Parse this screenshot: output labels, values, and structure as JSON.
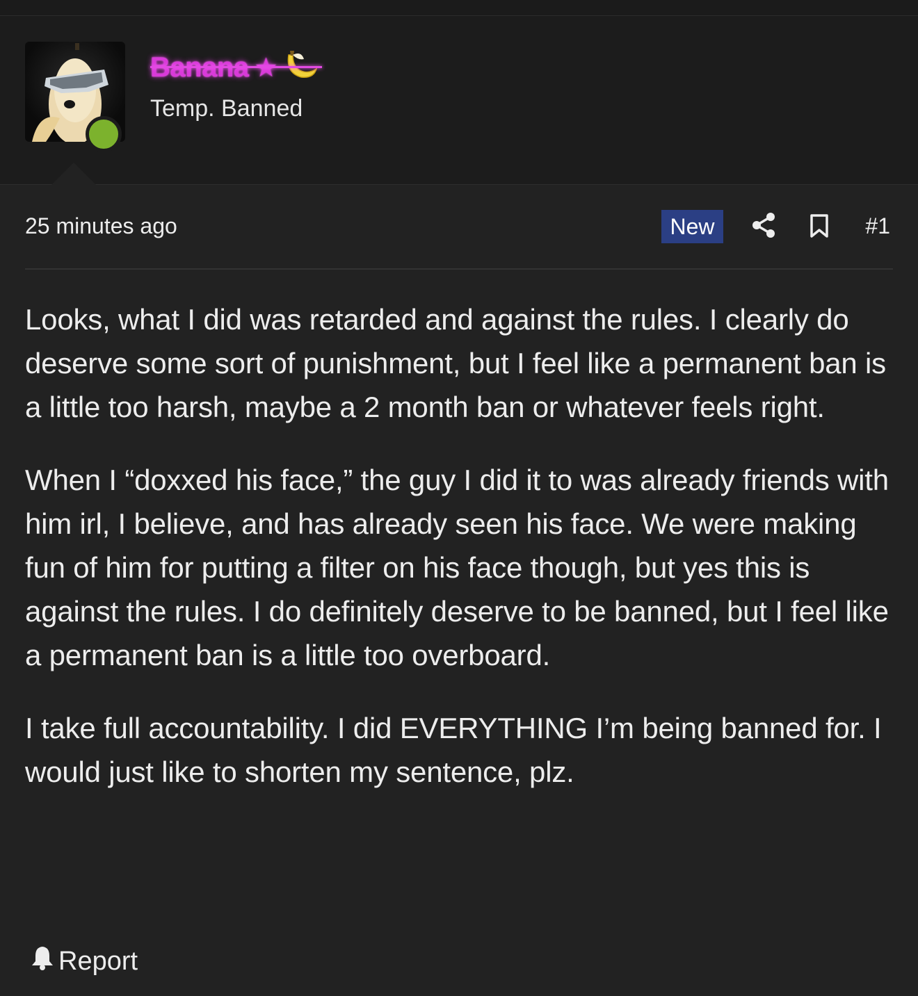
{
  "user": {
    "name": "Banana",
    "title": "Temp. Banned",
    "status": "online",
    "name_color": "#d93ad9",
    "status_color": "#7cb22d",
    "name_decorations": [
      "star-icon",
      "banana-icon"
    ]
  },
  "post": {
    "timestamp": "25 minutes ago",
    "badge": "New",
    "badge_color": "#2b3f84",
    "number": "#1",
    "paragraphs": [
      "Looks, what I did was retarded and against the rules. I clearly do deserve some sort of punishment, but I feel like a permanent ban is a little too harsh, maybe a 2 month ban or whatever feels right.",
      "When I “doxxed his face,” the guy I did it to was already friends with him irl, I believe, and has already seen his face. We were making fun of him for putting a filter on his face though, but yes this is against the rules. I do definitely deserve to be banned, but I feel like a permanent ban is a little too overboard.",
      "I take full accountability. I did EVERYTHING I’m being banned for. I would just like to shorten my sentence, plz."
    ],
    "actions": {
      "share_icon": "share-icon",
      "bookmark_icon": "bookmark-icon"
    }
  },
  "footer": {
    "report_label": "Report",
    "report_icon": "bell-icon"
  }
}
